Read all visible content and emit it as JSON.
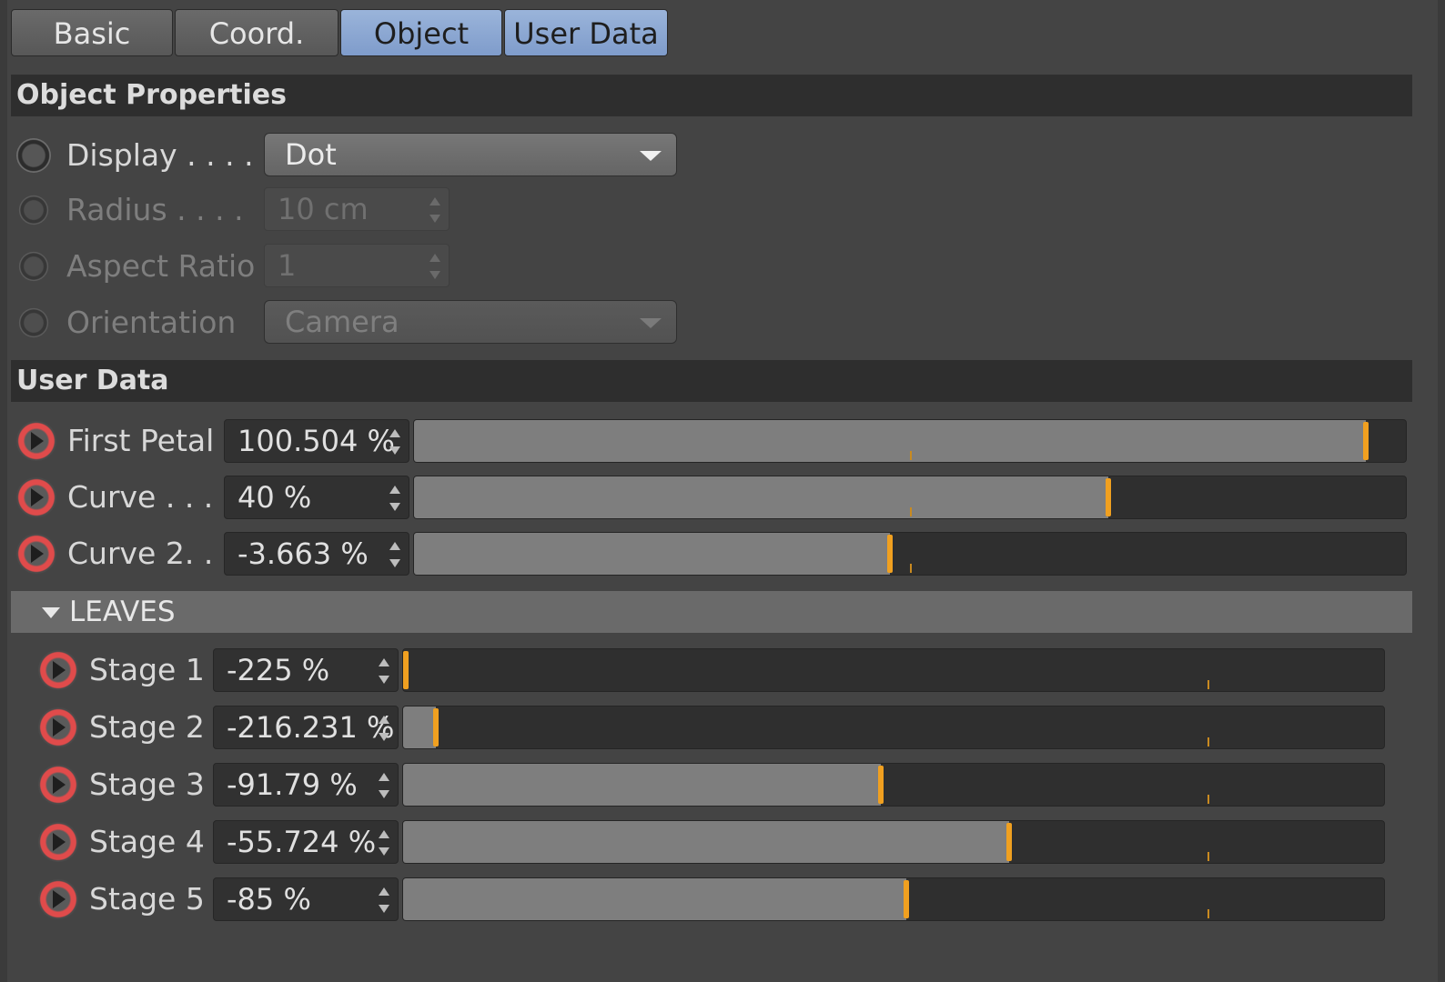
{
  "tabs": [
    "Basic",
    "Coord.",
    "Object",
    "User Data"
  ],
  "sections": {
    "object_properties": "Object Properties",
    "user_data": "User Data"
  },
  "object_props": {
    "display": {
      "label": "Display . . . .",
      "value": "Dot"
    },
    "radius": {
      "label": "Radius . . . .",
      "value": "10 cm"
    },
    "aspect_ratio": {
      "label": "Aspect Ratio",
      "value": "1"
    },
    "orientation": {
      "label": "Orientation",
      "value": "Camera"
    }
  },
  "user_data": [
    {
      "label": "First Petal",
      "value": "100.504 %",
      "level": 0.96
    },
    {
      "label": "Curve . . .",
      "value": "40 %",
      "level": 0.7
    },
    {
      "label": "Curve 2. .",
      "value": "-3.663 %",
      "level": 0.48
    }
  ],
  "leaves": {
    "title": "LEAVES",
    "items": [
      {
        "label": "Stage 1",
        "value": "-225 %",
        "level": 0.0
      },
      {
        "label": "Stage 2",
        "value": "-216.231 %",
        "level": 0.033
      },
      {
        "label": "Stage 3",
        "value": "-91.79 %",
        "level": 0.487
      },
      {
        "label": "Stage 4",
        "value": "-55.724 %",
        "level": 0.618
      },
      {
        "label": "Stage 5",
        "value": "-85 %",
        "level": 0.513
      }
    ]
  },
  "colors": {
    "accent_tab": "#8fa9d4",
    "slider_handle": "#f0a020",
    "keyframe_red": "#e04b4b"
  }
}
